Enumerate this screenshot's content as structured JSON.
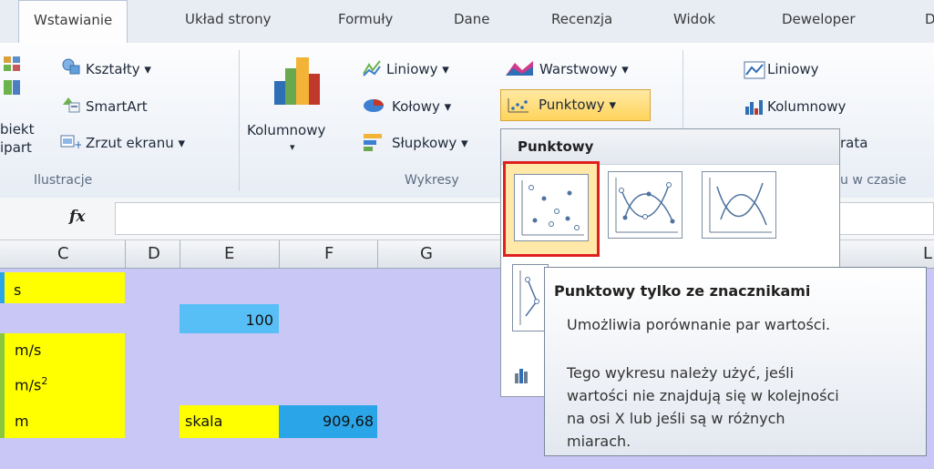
{
  "tabs": [
    "Wstawianie",
    "Układ strony",
    "Formuły",
    "Dane",
    "Recenzja",
    "Widok",
    "Deweloper",
    "D"
  ],
  "ribbon": {
    "ilustracje": {
      "ksztalty": "Kształty ▾",
      "smartart": "SmartArt",
      "obiekt_line1": "biekt",
      "obiekt_line2": "ipart",
      "zrzut": "Zrzut ekranu ▾",
      "group_label": "Ilustracje"
    },
    "wykresy": {
      "kolumnowy": "Kolumnowy",
      "kolumnowy_arrow": "▾",
      "liniowy": "Liniowy ▾",
      "kolowy": "Kołowy ▾",
      "slupkowy": "Słupkowy ▾",
      "warstwowy": "Warstwowy ▾",
      "punktowy": "Punktowy ▾",
      "group_label": "Wykresy"
    },
    "sparklines": {
      "liniowy": "Liniowy",
      "kolumnowy": "Kolumnowy",
      "partial": "rata",
      "group_label_partial": "u w czasie"
    }
  },
  "formula_bar": {
    "fx": "fx",
    "value": ""
  },
  "columns": [
    "C",
    "D",
    "E",
    "F",
    "G",
    "L"
  ],
  "cells": {
    "c1": "s",
    "e2": "100",
    "c3": "m/s",
    "c4_base": "m/s",
    "c4_sup": "2",
    "c5": "m",
    "e5": "skala",
    "f5": "909,68"
  },
  "dropdown": {
    "title": "Punktowy",
    "selected": "Punktowy tylko ze znacznikami"
  },
  "tooltip": {
    "title": "Punktowy tylko ze znacznikami",
    "line1": "Umożliwia porównanie par wartości.",
    "line2": "Tego wykresu należy użyć, jeśli",
    "line3": "wartości nie znajdują się w kolejności",
    "line4": "na osi X lub jeśli są w różnych",
    "line5": "miarach."
  },
  "colors": {
    "highlight_red": "#e02020",
    "cell_yellow": "#ffff00",
    "cell_blue": "#57bff5",
    "grid_lavender": "#c8c7f5",
    "accent_green": "#8bc63f"
  }
}
